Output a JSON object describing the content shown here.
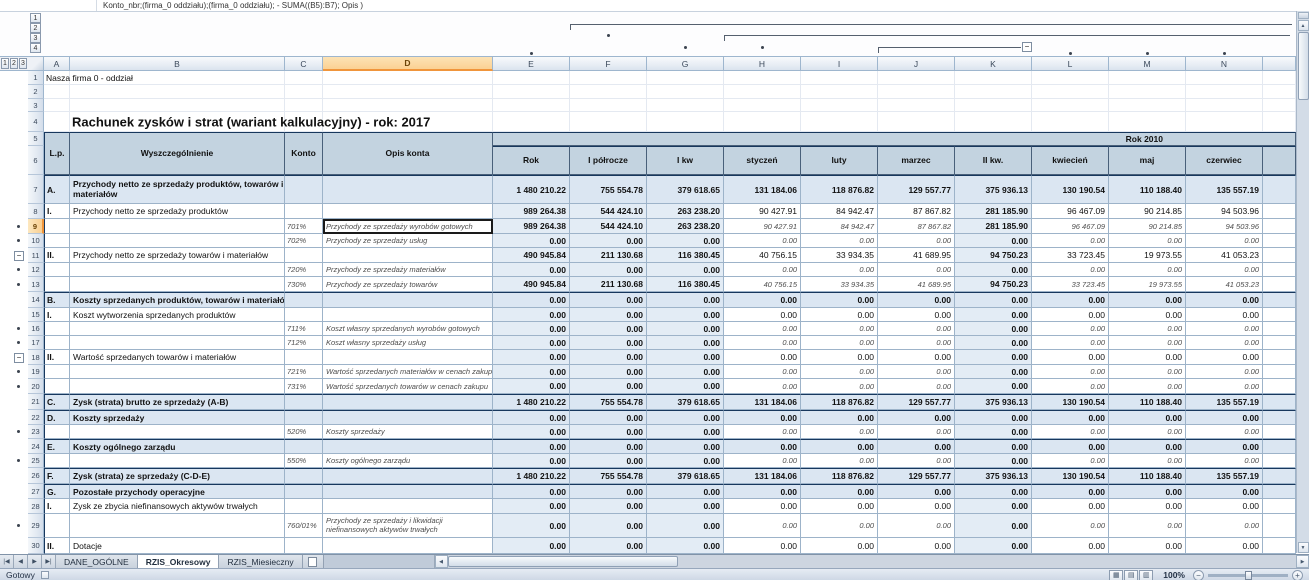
{
  "formula_bar": {
    "text": "Konto_nbr;(firma_0 oddziału);(firma_0 oddziału); - SUMA((B5):B7); Opis )"
  },
  "grid": {
    "column_letters": [
      "A",
      "B",
      "C",
      "D",
      "E",
      "F",
      "G",
      "H",
      "I",
      "J",
      "K",
      "L",
      "M",
      "N"
    ],
    "selected_column": "D",
    "selected_row": 9,
    "outline": {
      "col_levels": [
        "1",
        "2",
        "3",
        "4"
      ],
      "row_levels": [
        "1",
        "2",
        "3"
      ]
    }
  },
  "sheet": {
    "header": {
      "lp": "L.p.",
      "wyszczegolnienie": "Wyszczególnienie",
      "konto": "Konto",
      "opis": "Opis konta",
      "year_band": "Rok 2010",
      "period_cols": [
        "Rok",
        "I półrocze",
        "I kw",
        "styczeń",
        "luty",
        "marzec",
        "II kw.",
        "kwiecień",
        "maj",
        "czerwiec"
      ]
    },
    "value_sets": {
      "A": [
        "1 480 210.22",
        "755 554.78",
        "379 618.65",
        "131 184.06",
        "118 876.82",
        "129 557.77",
        "375 936.13",
        "130 190.54",
        "110 188.40",
        "135 557.19"
      ],
      "P": [
        "989 264.38",
        "544 424.10",
        "263 238.20",
        "90 427.91",
        "84 942.47",
        "87 867.82",
        "281 185.90",
        "96 467.09",
        "90 214.85",
        "94 503.96"
      ],
      "T": [
        "490 945.84",
        "211 130.68",
        "116 380.45",
        "40 756.15",
        "33 934.35",
        "41 689.95",
        "94 750.23",
        "33 723.45",
        "19 973.55",
        "41 053.23"
      ],
      "Z": [
        "0.00",
        "0.00",
        "0.00",
        "0.00",
        "0.00",
        "0.00",
        "0.00",
        "0.00",
        "0.00",
        "0.00"
      ]
    },
    "rows": [
      {
        "num": 1,
        "type": "text",
        "text": "Nasza firma 0 - oddział"
      },
      {
        "num": 2,
        "type": "blank"
      },
      {
        "num": 3,
        "type": "blank"
      },
      {
        "num": 4,
        "type": "title",
        "text": "Rachunek zysków i strat  (wariant kalkulacyjny)  - rok: 2017"
      },
      {
        "type": "header"
      },
      {
        "num": 7,
        "type": "section",
        "lp": "A.",
        "name": "Przychody netto ze sprzedaży produktów, towarów i materiałów",
        "values_ref": "A"
      },
      {
        "num": 8,
        "type": "sub",
        "lp": "I.",
        "name": "Przychody netto ze sprzedaży produktów",
        "values_ref": "P"
      },
      {
        "num": 9,
        "type": "detail",
        "konto": "701%",
        "opis": "Przychody ze sprzedaży wyrobów gotowych",
        "values_ref": "P",
        "marker": "dot",
        "selected": true
      },
      {
        "num": 10,
        "type": "detail",
        "konto": "702%",
        "opis": "Przychody ze sprzedaży usług",
        "values_ref": "Z",
        "marker": "dot"
      },
      {
        "num": 11,
        "type": "sub",
        "lp": "II.",
        "name": "Przychody netto ze sprzedaży towarów i materiałów",
        "values_ref": "T",
        "marker": "minus"
      },
      {
        "num": 12,
        "type": "detail",
        "konto": "720%",
        "opis": "Przychody ze sprzedaży materiałów",
        "values_ref": "Z",
        "marker": "dot"
      },
      {
        "num": 13,
        "type": "detail",
        "konto": "730%",
        "opis": "Przychody ze sprzedaży towarów",
        "values_ref": "T",
        "marker": "dot"
      },
      {
        "num": 14,
        "type": "section",
        "lp": "B.",
        "name": "Koszty sprzedanych produktów, towarów i materiałów",
        "values_ref": "Z"
      },
      {
        "num": 15,
        "type": "sub",
        "lp": "I.",
        "name": "Koszt wytworzenia sprzedanych produktów",
        "values_ref": "Z"
      },
      {
        "num": 16,
        "type": "detail",
        "konto": "711%",
        "opis": "Koszt własny sprzedanych wyrobów gotowych",
        "values_ref": "Z",
        "marker": "dot"
      },
      {
        "num": 17,
        "type": "detail",
        "konto": "712%",
        "opis": "Koszt własny sprzedaży usług",
        "values_ref": "Z",
        "marker": "dot"
      },
      {
        "num": 18,
        "type": "sub",
        "lp": "II.",
        "name": "Wartość sprzedanych towarów i materiałów",
        "values_ref": "Z",
        "marker": "minus"
      },
      {
        "num": 19,
        "type": "detail",
        "konto": "721%",
        "opis": "Wartość sprzedanych materiałów w cenach zakupu",
        "values_ref": "Z",
        "marker": "dot"
      },
      {
        "num": 20,
        "type": "detail",
        "konto": "731%",
        "opis": "Wartość sprzedanych towarów w cenach zakupu",
        "values_ref": "Z",
        "marker": "dot"
      },
      {
        "num": 21,
        "type": "section",
        "lp": "C.",
        "name": "Zysk (strata) brutto ze sprzedaży (A-B)",
        "values_ref": "A"
      },
      {
        "num": 22,
        "type": "section",
        "lp": "D.",
        "name": "Koszty sprzedaży",
        "values_ref": "Z"
      },
      {
        "num": 23,
        "type": "detail",
        "konto": "520%",
        "opis": "Koszty sprzedaży",
        "values_ref": "Z",
        "marker": "dot"
      },
      {
        "num": 24,
        "type": "section",
        "lp": "E.",
        "name": "Koszty ogólnego zarządu",
        "values_ref": "Z"
      },
      {
        "num": 25,
        "type": "detail",
        "konto": "550%",
        "opis": "Koszty ogólnego zarządu",
        "values_ref": "Z",
        "marker": "dot"
      },
      {
        "num": 26,
        "type": "section",
        "lp": "F.",
        "name": "Zysk (strata) ze sprzedaży (C-D-E)",
        "values_ref": "A"
      },
      {
        "num": 27,
        "type": "section",
        "lp": "G.",
        "name": "Pozostałe przychody operacyjne",
        "values_ref": "Z"
      },
      {
        "num": 28,
        "type": "sub",
        "lp": "I.",
        "name": "Zysk ze zbycia niefinansowych aktywów trwałych",
        "values_ref": "Z"
      },
      {
        "num": 29,
        "type": "detail",
        "konto": "760/01%",
        "opis": "Przychody ze sprzedaży i likwidacji niefinansowych aktywów trwałych",
        "values_ref": "Z",
        "marker": "dot"
      },
      {
        "num": 30,
        "type": "sub",
        "lp": "II.",
        "name": "Dotacje",
        "values_ref": "Z"
      }
    ]
  },
  "tabs": {
    "items": [
      {
        "label": "DANE_OGÓLNE",
        "active": false
      },
      {
        "label": "RZIS_Okresowy",
        "active": true
      },
      {
        "label": "RZIS_Miesieczny",
        "active": false
      }
    ]
  },
  "status": {
    "ready": "Gotowy",
    "zoom": "100%"
  }
}
